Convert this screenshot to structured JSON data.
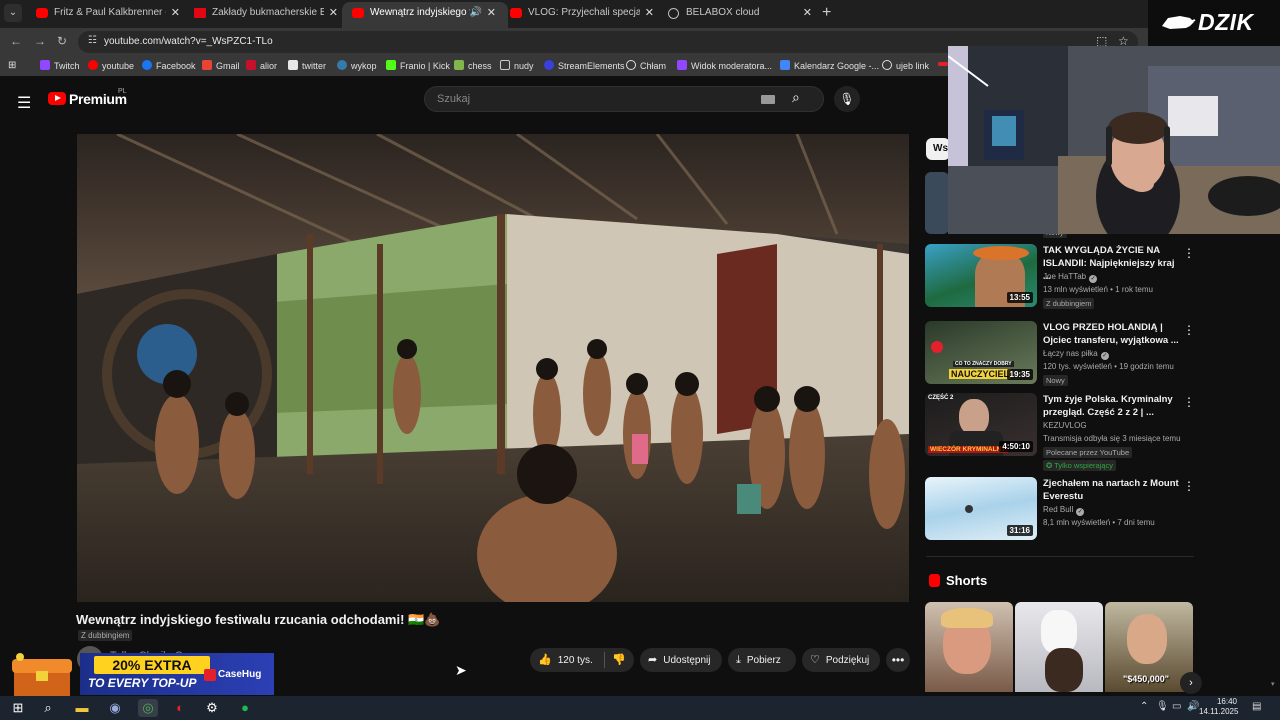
{
  "browser": {
    "tabs": [
      {
        "title": "Fritz & Paul Kalkbrenner - Sky a",
        "favicon": "youtube",
        "active": false
      },
      {
        "title": "Zakłady bukmacherskie Betclic",
        "favicon": "betclic",
        "active": false
      },
      {
        "title": "Wewnątrz indyjskiego festi",
        "favicon": "youtube",
        "active": true
      },
      {
        "title": "VLOG: Przyjechali specjalnie do",
        "favicon": "youtube",
        "active": false
      },
      {
        "title": "BELABOX cloud",
        "favicon": "globe",
        "active": false
      }
    ],
    "url": "youtube.com/watch?v=_WsPZC1-TLo",
    "bookmarks": [
      {
        "label": "Twitch",
        "color": "#9146ff"
      },
      {
        "label": "youtube",
        "color": "#ff0000"
      },
      {
        "label": "Facebook",
        "color": "#1877f2"
      },
      {
        "label": "Gmail",
        "color": "#ea4335"
      },
      {
        "label": "alior",
        "color": "#c8102e"
      },
      {
        "label": "twitter",
        "color": "#e7e7e7"
      },
      {
        "label": "wykop",
        "color": "#367aa9"
      },
      {
        "label": "Franio | Kick",
        "color": "#53fc18"
      },
      {
        "label": "chess",
        "color": "#81b64c"
      },
      {
        "label": "nudy",
        "color": "#cccccc"
      },
      {
        "label": "StreamElements",
        "color": "#3b3fdc"
      },
      {
        "label": "Chłam",
        "color": "#dddddd"
      },
      {
        "label": "Widok moderatora...",
        "color": "#9146ff"
      },
      {
        "label": "Kalendarz Google -...",
        "color": "#4285f4"
      },
      {
        "label": "ujeb link",
        "color": "#dddddd"
      }
    ]
  },
  "youtube": {
    "logo_text": "Premium",
    "country_code": "PL",
    "search_placeholder": "Szukaj",
    "video": {
      "title": "Wewnątrz indyjskiego festiwalu rzucania odchodami! 🇮🇳💩",
      "dub_label": "Z dubbingiem",
      "channel_partial": "Tylko Chwila C...",
      "like_count": "120 tys.",
      "share_label": "Udostępnij",
      "download_label": "Pobierz",
      "thanks_label": "Podziękuj"
    },
    "filter_chip": "Wsz",
    "top_badge": "Nowy",
    "recommendations": [
      {
        "title": "TAK WYGLĄDA ŻYCIE NA ISLANDII: Najpiękniejszy kraj ...",
        "channel": "Joe HaTTab",
        "meta": "13 mln wyświetleń • 1 rok temu",
        "badges": [
          "Z dubbingiem"
        ],
        "duration": "13:55",
        "verified": true
      },
      {
        "title": "VLOG PRZED HOLANDIĄ | Ojciec transferu, wyjątkowa ...",
        "channel": "Łączy nas piłka",
        "meta": "120 tys. wyświetleń • 19 godzin temu",
        "badges": [
          "Nowy"
        ],
        "duration": "19:35",
        "thumb_text": "NAUCZYCIEL",
        "thumb_subtext": "CO TO ZNACZY DOBRY",
        "verified": true
      },
      {
        "title": "Tym żyje Polska. Kryminalny przegląd. Część 2 z 2 | ...",
        "channel": "KEZUVLOG",
        "meta": "Transmisja odbyła się 3 miesiące temu",
        "badges": [
          "Polecane przez YouTube",
          "Tylko wspierający"
        ],
        "duration": "4:50:10",
        "thumb_text": "WIECZÓR KRYMINALNY",
        "thumb_subtext": "CZĘŚĆ 2",
        "verified": false
      },
      {
        "title": "Zjechałem na nartach z Mount Everestu",
        "channel": "Red Bull",
        "meta": "8,1 mln wyświetleń • 7 dni temu",
        "badges": [],
        "duration": "31:16",
        "verified": true
      }
    ],
    "shorts_title": "Shorts",
    "shorts": [
      {
        "label": ""
      },
      {
        "label": ""
      },
      {
        "label": "\"$450,000\""
      }
    ]
  },
  "overlay": {
    "brand": "DZIK",
    "ad": {
      "headline": "20% EXTRA",
      "subline": "TO EVERY TOP-UP",
      "brand": "CaseHug"
    }
  },
  "taskbar": {
    "time": "16:40",
    "date": "14.11.2025"
  },
  "colors": {
    "accent_red": "#ff0000",
    "background": "#0f0f0f",
    "pill": "#272727",
    "support_green": "#2ba640"
  }
}
